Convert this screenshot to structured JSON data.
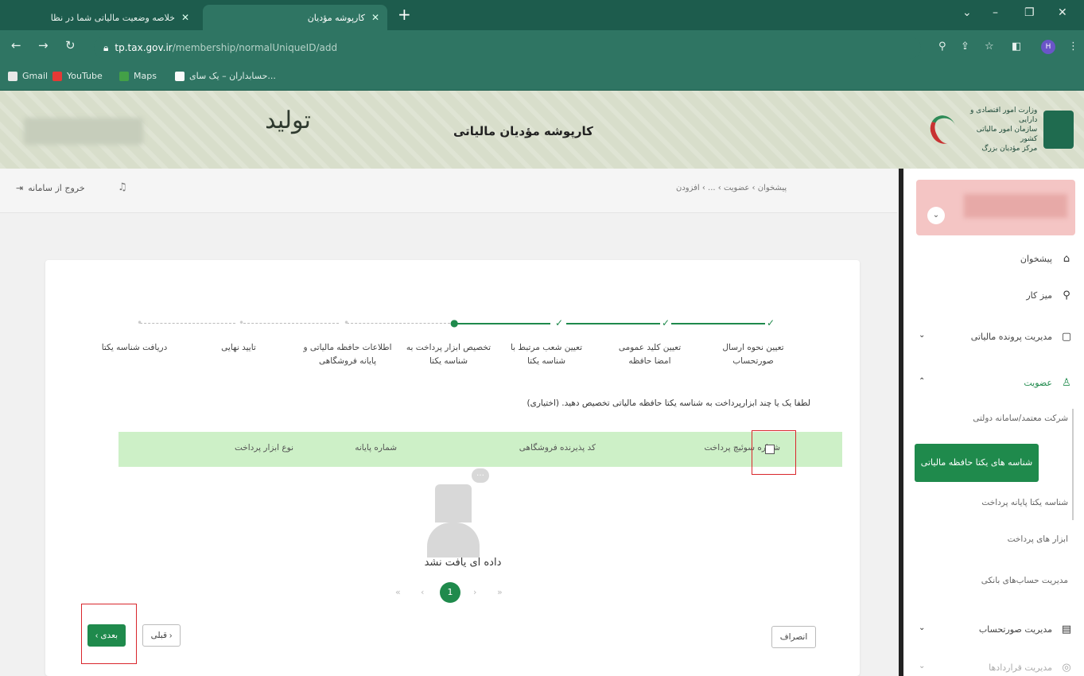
{
  "browser": {
    "tabs": [
      {
        "label": "خلاصه وضعیت مالیاتی شما در نظا"
      },
      {
        "label": "کارپوشه مؤدیان"
      }
    ],
    "new_tab": "+",
    "url_host": "tp.tax.gov.ir",
    "url_path": "/membership/normalUniqueID/add",
    "profile_initial": "H",
    "bookmarks": [
      "Gmail",
      "YouTube",
      "Maps",
      "حسابداران – یک سای..."
    ]
  },
  "header": {
    "title": "کارپوشه مؤدیان مالیاتی",
    "slogan": "تولید",
    "ministry_line1": "وزارت امور اقتصادی و دارایی",
    "ministry_line2": "سازمان امور مالیاتی کشور",
    "ministry_line3": "مرکز مؤدیان بزرگ"
  },
  "topbar": {
    "logout": "خروج از سامانه",
    "breadcrumb": "پیشخوان  ›  عضویت  ›  ...  ›  افزودن"
  },
  "sidebar": {
    "items": [
      {
        "label": "پیشخوان",
        "icon": "⌂"
      },
      {
        "label": "میز کار",
        "icon": "⚲"
      },
      {
        "label": "مدیریت پرونده مالیاتی",
        "icon": "▢",
        "arrow": "⌄"
      },
      {
        "label": "عضویت",
        "icon": "♙",
        "arrow": "⌃"
      }
    ],
    "sub_items": [
      "شرکت معتمد/سامانه دولتی",
      "شناسه های یکتا حافظه مالیاتی",
      "شناسه یکتا پایانه پرداخت",
      "ابزار های پرداخت",
      "مدیریت حساب‌های بانکی"
    ],
    "more_items": [
      {
        "label": "مدیریت صورتحساب",
        "icon": "▤",
        "arrow": "⌄"
      },
      {
        "label": "مدیریت قراردادها",
        "icon": "◎",
        "arrow": "⌄"
      }
    ]
  },
  "steps": [
    {
      "label": "تعیین نحوه ارسال صورتحساب",
      "state": "done"
    },
    {
      "label": "تعیین کلید عمومی امضا حافظه",
      "state": "done"
    },
    {
      "label": "تعیین شعب مرتبط با شناسه یکتا",
      "state": "done"
    },
    {
      "label": "تخصیص ابزار پرداخت به شناسه یکتا",
      "state": "current"
    },
    {
      "label": "اطلاعات حافظه مالیاتی و پایانه فروشگاهی",
      "state": "todo"
    },
    {
      "label": "تایید نهایی",
      "state": "todo"
    },
    {
      "label": "دریافت شناسه یکتا",
      "state": "todo"
    }
  ],
  "hint": "لطفا یک یا چند ابزارپرداخت به شناسه یکتا حافظه مالیاتی تخصیص دهید. (اختیاری)",
  "table": {
    "columns": [
      "شماره سوئیچ پرداخت",
      "کد پذیرنده فروشگاهی",
      "شماره پایانه",
      "نوع ابزار پرداخت"
    ],
    "empty_text": "داده ای یافت نشد"
  },
  "pager": {
    "current": "1"
  },
  "buttons": {
    "next": "بعدی ›",
    "prev": "‹ قبلی",
    "cancel": "انصراف"
  },
  "colors": {
    "accent": "#1f8a4c",
    "table_header": "#cdf0c7",
    "highlight_box": "#d9262c"
  }
}
